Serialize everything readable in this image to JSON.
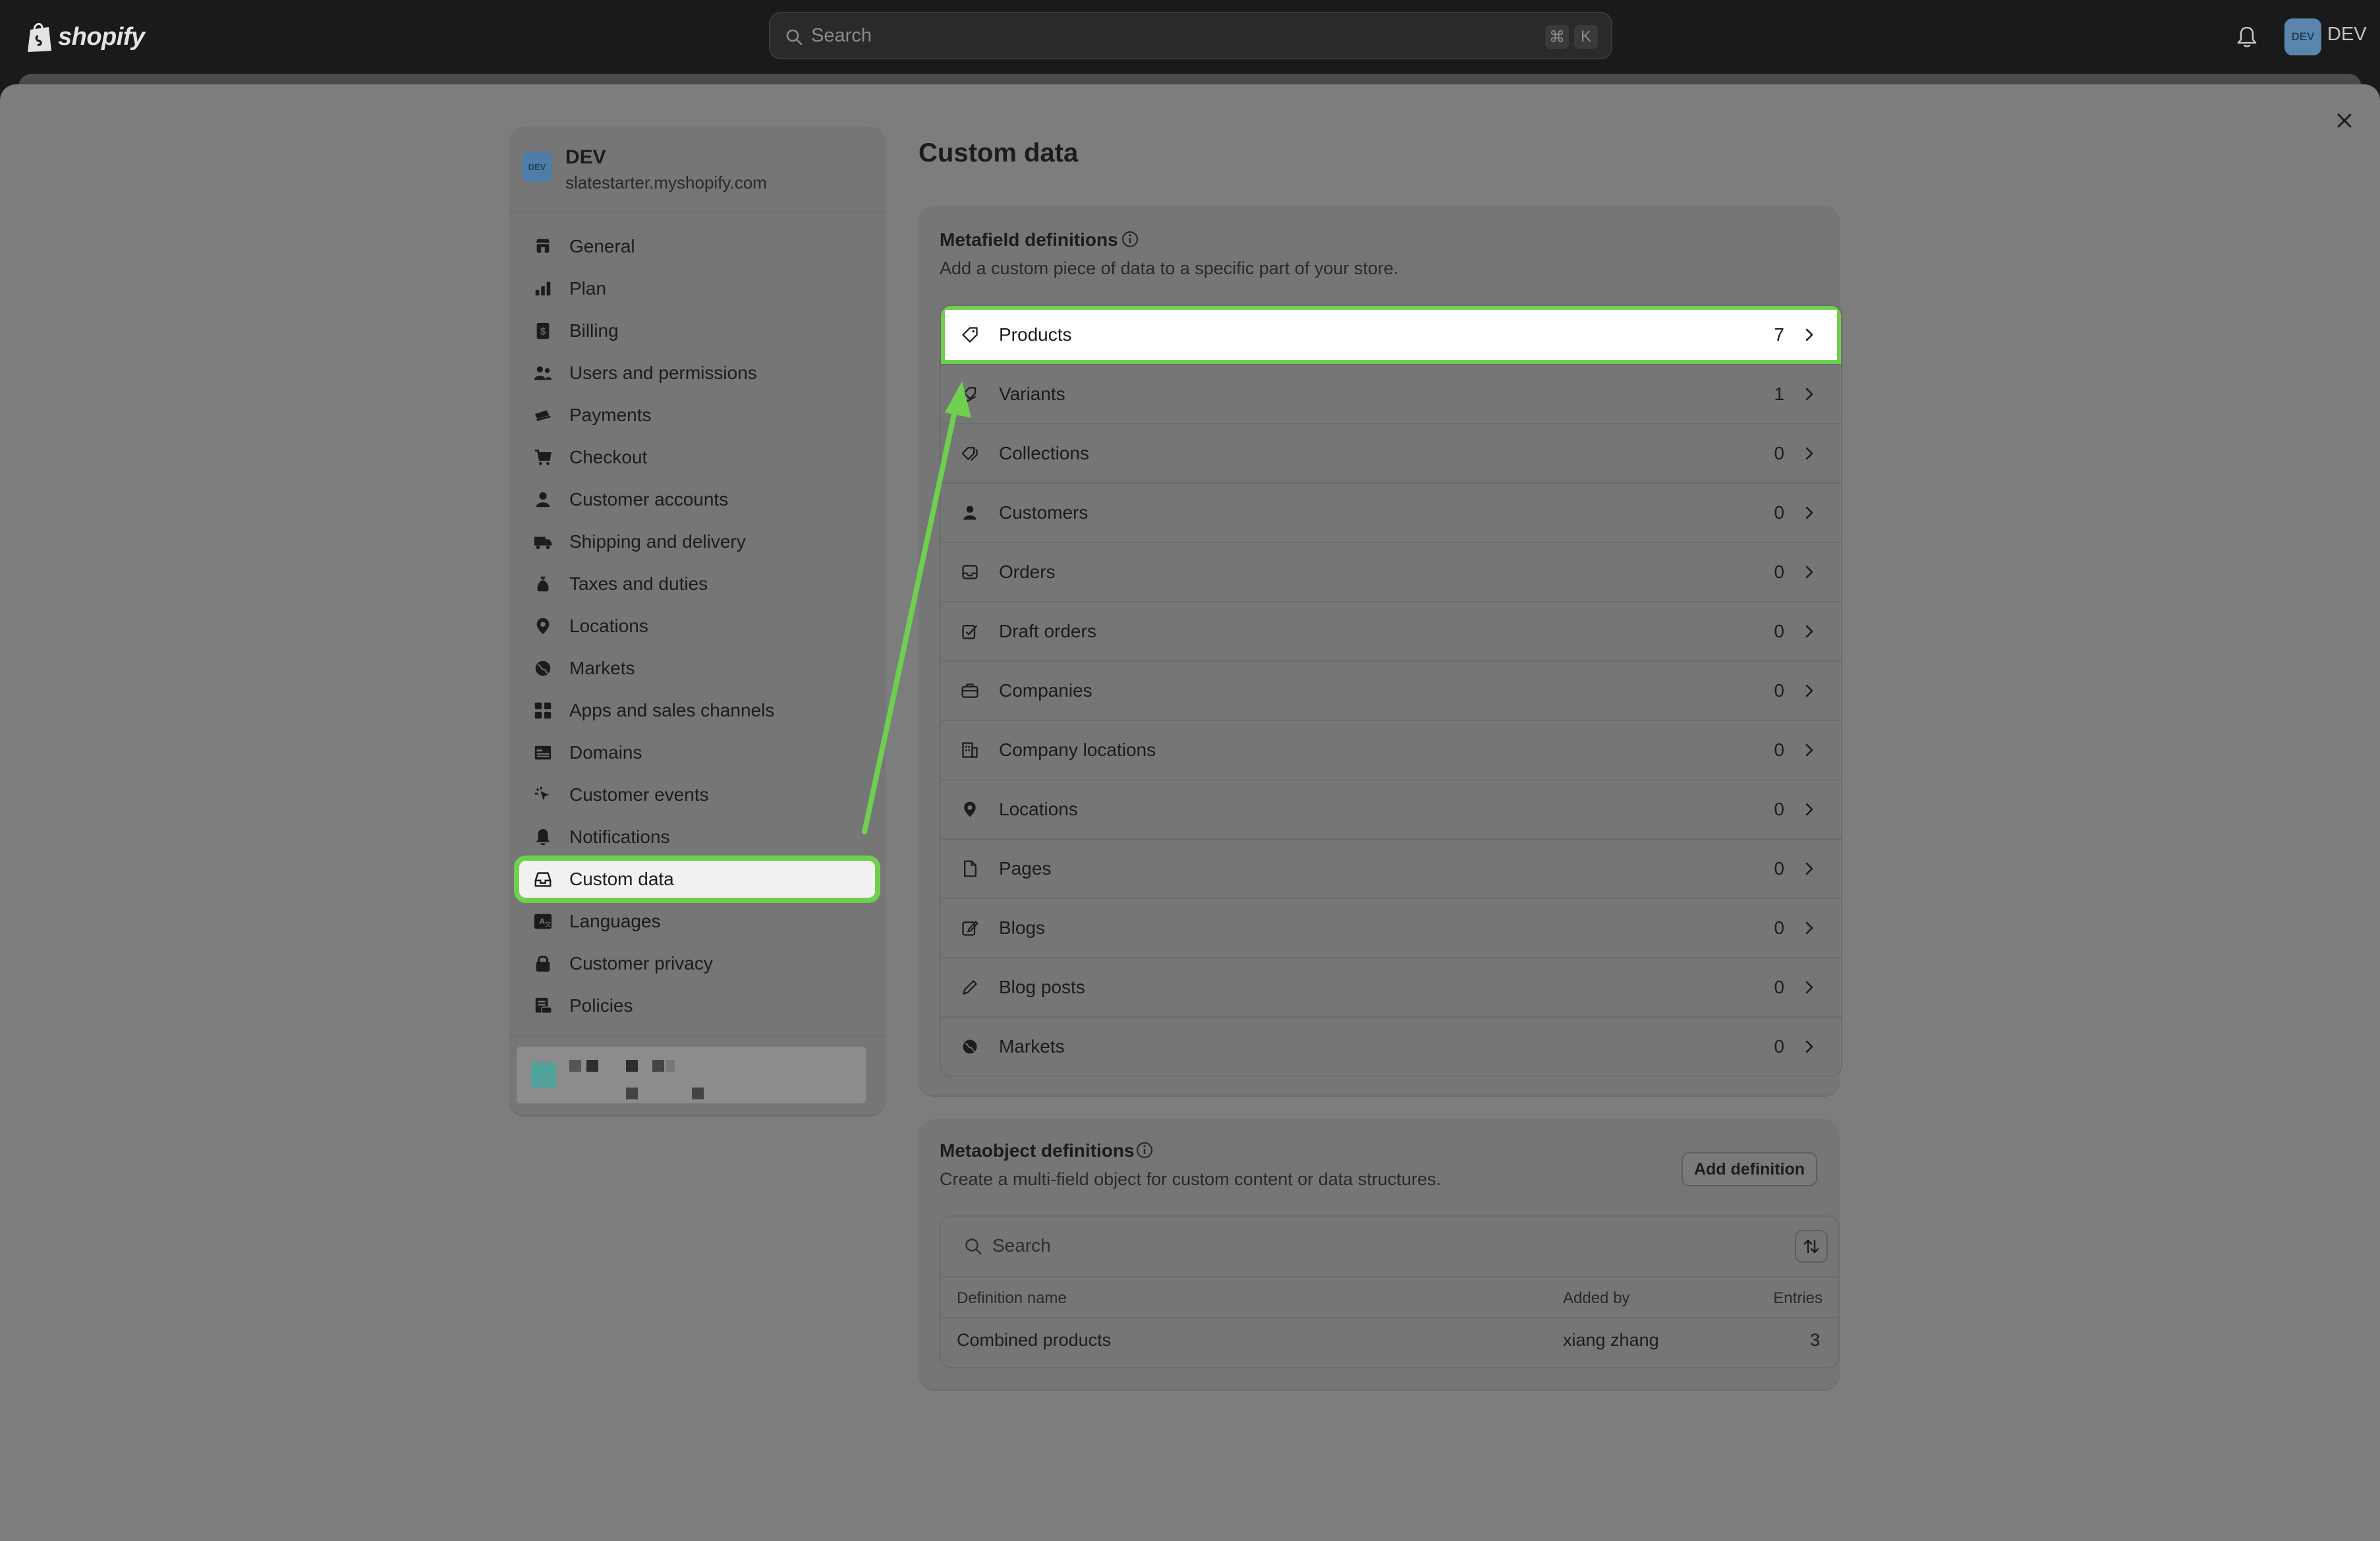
{
  "topbar": {
    "logo_text": "shopify",
    "search_placeholder": "Search",
    "shortcut_cmd": "⌘",
    "shortcut_key": "K",
    "avatar_initials": "DEV",
    "avatar_name": "DEV"
  },
  "store": {
    "avatar_initials": "DEV",
    "name": "DEV",
    "url": "slatestarter.myshopify.com"
  },
  "nav": {
    "items": [
      {
        "label": "General",
        "icon": "store-icon"
      },
      {
        "label": "Plan",
        "icon": "plan-icon"
      },
      {
        "label": "Billing",
        "icon": "billing-icon"
      },
      {
        "label": "Users and permissions",
        "icon": "users-icon"
      },
      {
        "label": "Payments",
        "icon": "payments-icon"
      },
      {
        "label": "Checkout",
        "icon": "cart-icon"
      },
      {
        "label": "Customer accounts",
        "icon": "person-icon"
      },
      {
        "label": "Shipping and delivery",
        "icon": "truck-icon"
      },
      {
        "label": "Taxes and duties",
        "icon": "taxes-icon"
      },
      {
        "label": "Locations",
        "icon": "location-icon"
      },
      {
        "label": "Markets",
        "icon": "globe-icon"
      },
      {
        "label": "Apps and sales channels",
        "icon": "apps-icon"
      },
      {
        "label": "Domains",
        "icon": "domains-icon"
      },
      {
        "label": "Customer events",
        "icon": "cursor-icon"
      },
      {
        "label": "Notifications",
        "icon": "bell-icon"
      },
      {
        "label": "Custom data",
        "icon": "custom-data-icon",
        "active": true
      },
      {
        "label": "Languages",
        "icon": "language-icon"
      },
      {
        "label": "Customer privacy",
        "icon": "lock-icon"
      },
      {
        "label": "Policies",
        "icon": "policies-icon"
      }
    ]
  },
  "page": {
    "title": "Custom data"
  },
  "metafields": {
    "title": "Metafield definitions",
    "subtitle": "Add a custom piece of data to a specific part of your store.",
    "rows": [
      {
        "label": "Products",
        "count": "7",
        "icon": "tag-icon",
        "highlight": true
      },
      {
        "label": "Variants",
        "count": "1",
        "icon": "variants-icon"
      },
      {
        "label": "Collections",
        "count": "0",
        "icon": "collections-icon"
      },
      {
        "label": "Customers",
        "count": "0",
        "icon": "person-icon"
      },
      {
        "label": "Orders",
        "count": "0",
        "icon": "inbox-icon"
      },
      {
        "label": "Draft orders",
        "count": "0",
        "icon": "draft-icon"
      },
      {
        "label": "Companies",
        "count": "0",
        "icon": "briefcase-icon"
      },
      {
        "label": "Company locations",
        "count": "0",
        "icon": "building-icon"
      },
      {
        "label": "Locations",
        "count": "0",
        "icon": "location-icon"
      },
      {
        "label": "Pages",
        "count": "0",
        "icon": "page-icon"
      },
      {
        "label": "Blogs",
        "count": "0",
        "icon": "blog-icon"
      },
      {
        "label": "Blog posts",
        "count": "0",
        "icon": "pencil-icon"
      },
      {
        "label": "Markets",
        "count": "0",
        "icon": "globe-icon"
      }
    ]
  },
  "metaobjects": {
    "title": "Metaobject definitions",
    "subtitle": "Create a multi-field object for custom content or data structures.",
    "add_button": "Add definition",
    "search_placeholder": "Search",
    "columns": [
      "Definition name",
      "Added by",
      "Entries"
    ],
    "rows": [
      {
        "name": "Combined products",
        "added_by": "xiang zhang",
        "entries": "3"
      }
    ]
  },
  "colors": {
    "highlight": "#6fcf4f",
    "topbar": "#1a1a1a",
    "overlay": "#7d7d7d",
    "avatar": "#5a86ad"
  }
}
